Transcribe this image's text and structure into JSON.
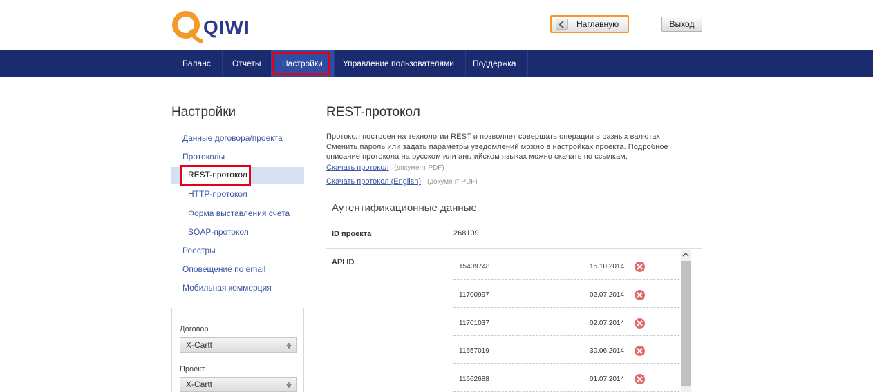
{
  "brand": {
    "name": "QIWI"
  },
  "header": {
    "home_label": "Наглавную",
    "logout_label": "Выход"
  },
  "nav": {
    "items": [
      {
        "label": "Баланс"
      },
      {
        "label": "Отчеты"
      },
      {
        "label": "Настройки"
      },
      {
        "label": "Управление пользователями"
      },
      {
        "label": "Поддержка"
      }
    ],
    "active": "Настройки"
  },
  "sidebar": {
    "title": "Настройки",
    "items": [
      {
        "label": "Данные договора/проекта"
      },
      {
        "label": "Протоколы"
      },
      {
        "label": "REST-протокол"
      },
      {
        "label": "HTTP-протокол"
      },
      {
        "label": "Форма выставления счета"
      },
      {
        "label": "SOAP-протокол"
      },
      {
        "label": "Реестры"
      },
      {
        "label": "Оповещение по email"
      },
      {
        "label": "Мобильная коммерция"
      }
    ],
    "filters": {
      "contract_label": "Договор",
      "contract_value": "X-Cartt",
      "project_label": "Проект",
      "project_value": "X-Cartt"
    }
  },
  "main": {
    "title": "REST-протокол",
    "description": [
      "Протокол построен на технологии REST и позволяет совершать операции в разных валютах",
      "Сменить пароль или задать параметры уведомлений можно в настройках проекта. Подробное",
      "описание протокола на русском или английском языках можно скачать по ссылкам."
    ],
    "downloads": [
      {
        "link": "Скачать протокол",
        "note": "(документ PDF)"
      },
      {
        "link": "Скачать протокол (English)",
        "note": "(документ PDF)"
      }
    ],
    "auth": {
      "title": "Аутентификационные данные",
      "project_id_label": "ID проекта",
      "project_id": "268109",
      "api_id_label": "API ID",
      "api_ids": [
        {
          "id": "15409748",
          "date": "15.10.2014"
        },
        {
          "id": "11700997",
          "date": "02.07.2014"
        },
        {
          "id": "11701037",
          "date": "02.07.2014"
        },
        {
          "id": "11657019",
          "date": "30.06.2014"
        },
        {
          "id": "11662688",
          "date": "01.07.2014"
        }
      ]
    }
  },
  "colors": {
    "nav_bg": "#1b2b70",
    "nav_active": "#2f4ea3",
    "highlight": "#e4001b",
    "brand_orange": "#f39a2a",
    "link": "#3b56a4"
  },
  "icons": {
    "logo": "qiwi-logo-icon",
    "back": "chevron-left-icon",
    "delete": "delete-circle-icon",
    "select_arrow": "arrow-down-icon"
  }
}
